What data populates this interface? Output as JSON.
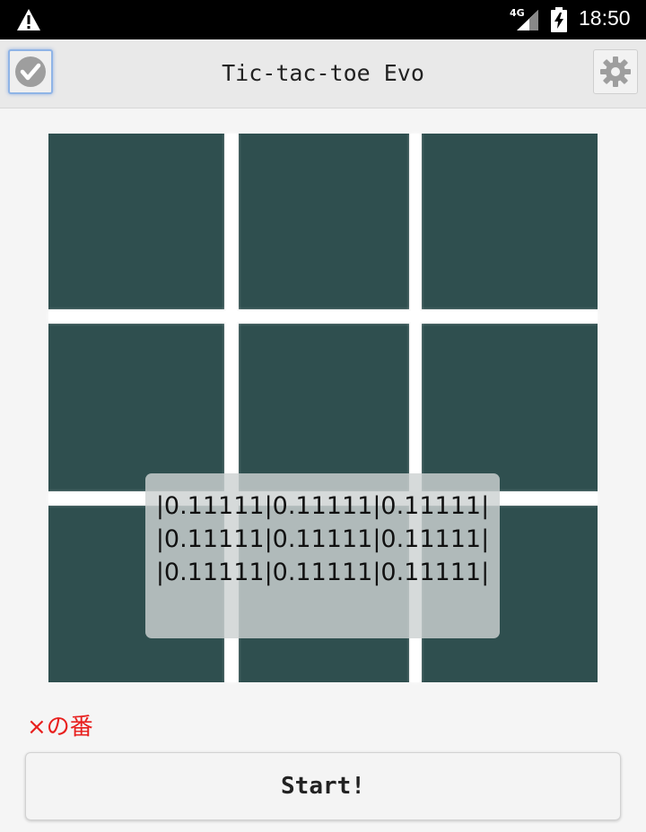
{
  "status_bar": {
    "network": "4G",
    "time": "18:50",
    "icons": [
      "warning-icon",
      "signal-icon",
      "battery-charging-icon"
    ]
  },
  "toolbar": {
    "title": "Tic-tac-toe Evo",
    "left_icon": "check-icon",
    "right_icon": "gear-icon"
  },
  "board": {
    "cell_color": "#2f4f4f",
    "cells": [
      "",
      "",
      "",
      "",
      "",
      "",
      "",
      "",
      ""
    ]
  },
  "probabilities": {
    "rows": [
      "|0.11111|0.11111|0.11111|",
      "|0.11111|0.11111|0.11111|",
      "|0.11111|0.11111|0.11111|"
    ]
  },
  "turn": {
    "label": "×の番",
    "color": "#e8201e"
  },
  "start_button": {
    "label": "Start!"
  }
}
